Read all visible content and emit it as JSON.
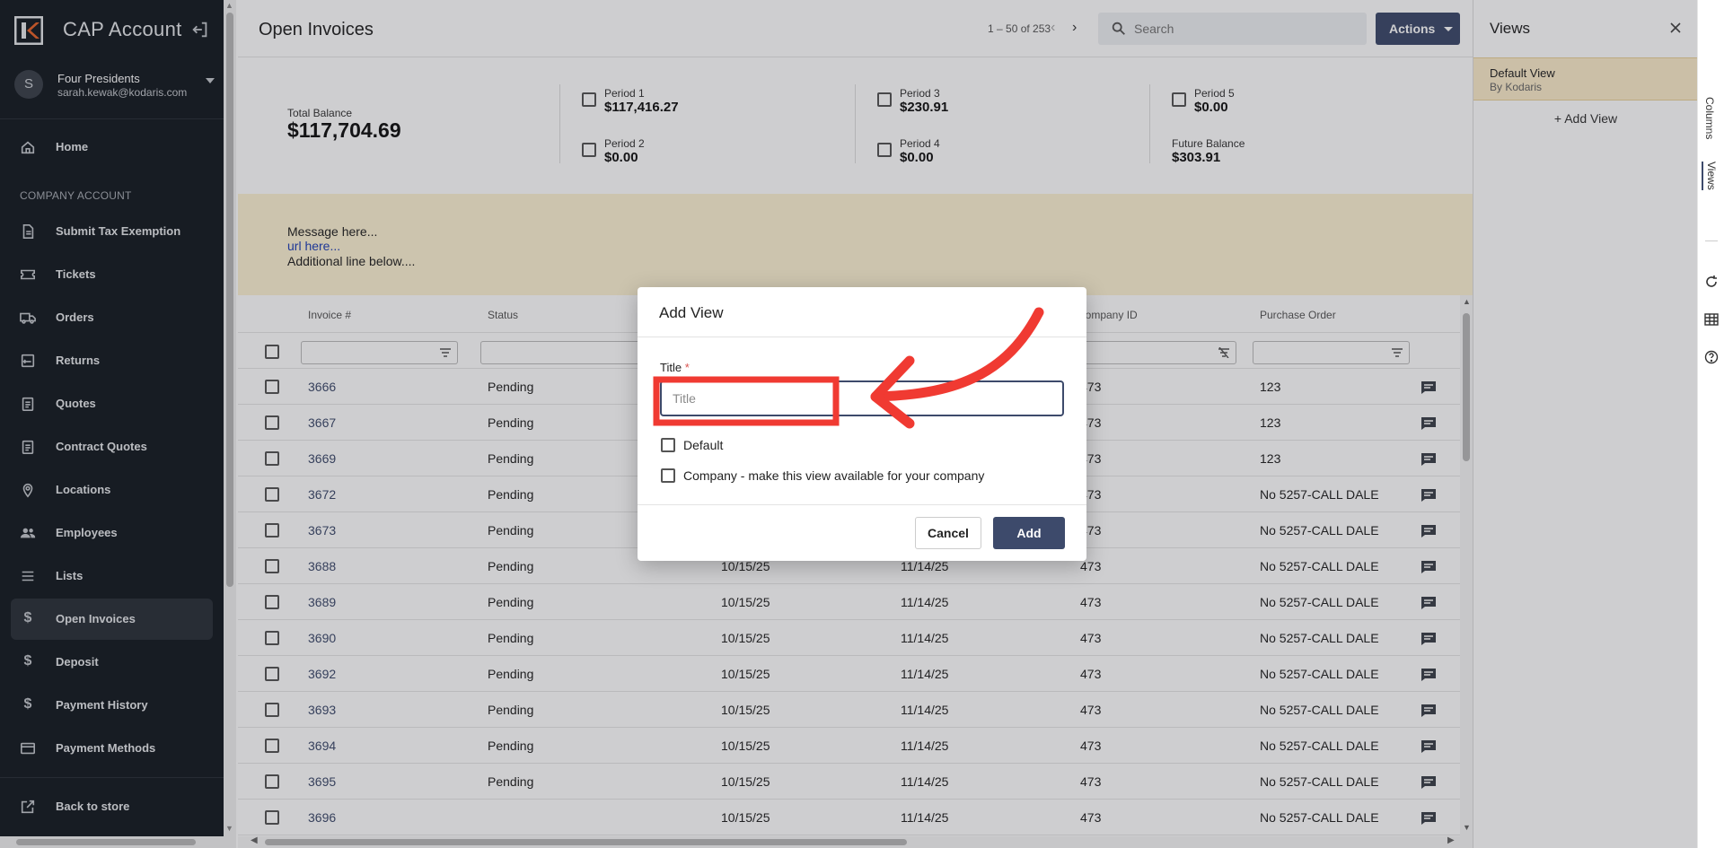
{
  "sidebar": {
    "brand": "CAP Account",
    "account": {
      "avatar_initial": "S",
      "name": "Four Presidents",
      "email": "sarah.kewak@kodaris.com"
    },
    "section_label": "COMPANY ACCOUNT",
    "home": "Home",
    "items": [
      {
        "label": "Submit Tax Exemption",
        "icon": "document-icon"
      },
      {
        "label": "Tickets",
        "icon": "ticket-icon"
      },
      {
        "label": "Orders",
        "icon": "truck-icon"
      },
      {
        "label": "Returns",
        "icon": "returns-icon"
      },
      {
        "label": "Quotes",
        "icon": "clipboard-icon"
      },
      {
        "label": "Contract Quotes",
        "icon": "clipboard-icon"
      },
      {
        "label": "Locations",
        "icon": "location-pin-icon"
      },
      {
        "label": "Employees",
        "icon": "people-icon"
      },
      {
        "label": "Lists",
        "icon": "list-icon"
      },
      {
        "label": "Open Invoices",
        "icon": "dollar-icon",
        "active": true
      },
      {
        "label": "Deposit",
        "icon": "dollar-icon"
      },
      {
        "label": "Payment History",
        "icon": "dollar-icon"
      },
      {
        "label": "Payment Methods",
        "icon": "credit-card-icon"
      }
    ],
    "back_to_store": "Back to store"
  },
  "header": {
    "title": "Open Invoices",
    "pager": "1 – 50 of 253",
    "search_placeholder": "Search",
    "actions_label": "Actions"
  },
  "summary": {
    "total_label": "Total Balance",
    "total_value": "$117,704.69",
    "periods": [
      {
        "label": "Period 1",
        "value": "$117,416.27"
      },
      {
        "label": "Period 2",
        "value": "$0.00"
      },
      {
        "label": "Period 3",
        "value": "$230.91"
      },
      {
        "label": "Period 4",
        "value": "$0.00"
      },
      {
        "label": "Period 5",
        "value": "$0.00"
      }
    ],
    "future_label": "Future Balance",
    "future_value": "$303.91"
  },
  "banner": {
    "line1": "Message here...",
    "link": "url here...",
    "line3": "Additional line below...."
  },
  "table": {
    "columns": [
      "Invoice #",
      "Status",
      "Company ID",
      "Purchase Order"
    ],
    "rows": [
      {
        "invoice": "3666",
        "status": "Pending",
        "date1": "",
        "date2": "",
        "company": "473",
        "po": "123"
      },
      {
        "invoice": "3667",
        "status": "Pending",
        "date1": "",
        "date2": "",
        "company": "473",
        "po": "123"
      },
      {
        "invoice": "3669",
        "status": "Pending",
        "date1": "",
        "date2": "",
        "company": "473",
        "po": "123"
      },
      {
        "invoice": "3672",
        "status": "Pending",
        "date1": "",
        "date2": "",
        "company": "473",
        "po": "No 5257-CALL DALE"
      },
      {
        "invoice": "3673",
        "status": "Pending",
        "date1": "",
        "date2": "",
        "company": "473",
        "po": "No 5257-CALL DALE"
      },
      {
        "invoice": "3688",
        "status": "Pending",
        "date1": "10/15/25",
        "date2": "11/14/25",
        "company": "473",
        "po": "No 5257-CALL DALE"
      },
      {
        "invoice": "3689",
        "status": "Pending",
        "date1": "10/15/25",
        "date2": "11/14/25",
        "company": "473",
        "po": "No 5257-CALL DALE"
      },
      {
        "invoice": "3690",
        "status": "Pending",
        "date1": "10/15/25",
        "date2": "11/14/25",
        "company": "473",
        "po": "No 5257-CALL DALE"
      },
      {
        "invoice": "3692",
        "status": "Pending",
        "date1": "10/15/25",
        "date2": "11/14/25",
        "company": "473",
        "po": "No 5257-CALL DALE"
      },
      {
        "invoice": "3693",
        "status": "Pending",
        "date1": "10/15/25",
        "date2": "11/14/25",
        "company": "473",
        "po": "No 5257-CALL DALE"
      },
      {
        "invoice": "3694",
        "status": "Pending",
        "date1": "10/15/25",
        "date2": "11/14/25",
        "company": "473",
        "po": "No 5257-CALL DALE"
      },
      {
        "invoice": "3695",
        "status": "Pending",
        "date1": "10/15/25",
        "date2": "11/14/25",
        "company": "473",
        "po": "No 5257-CALL DALE"
      },
      {
        "invoice": "3696",
        "status": "",
        "date1": "10/15/25",
        "date2": "11/14/25",
        "company": "473",
        "po": "No 5257-CALL DALE"
      }
    ]
  },
  "views_panel": {
    "title": "Views",
    "default_view": {
      "title": "Default View",
      "subtitle": "By Kodaris"
    },
    "add_view": "+ Add View",
    "tabs": [
      "Columns",
      "Views"
    ]
  },
  "modal": {
    "title": "Add View",
    "field_label": "Title",
    "required_mark": "*",
    "input_placeholder": "Title",
    "input_value": "",
    "checkbox_default": "Default",
    "checkbox_company": "Company - make this view available for your company",
    "cancel_label": "Cancel",
    "add_label": "Add"
  },
  "colors": {
    "sidebar_bg": "#151b22",
    "accent": "#3d4a6b",
    "banner_bg": "#fdf3d4",
    "annotation_red": "#f03a32"
  }
}
